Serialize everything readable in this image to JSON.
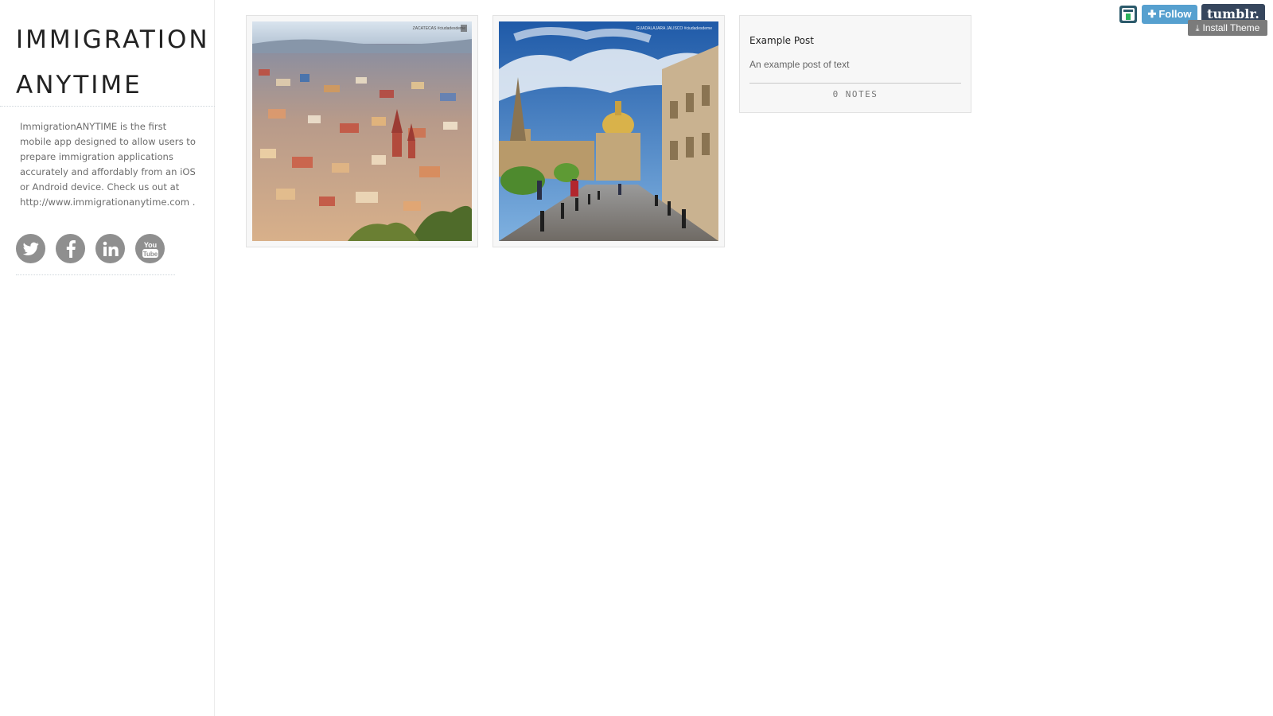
{
  "blog": {
    "title": "IMMIGRATION ANYTIME",
    "description": "ImmigrationANYTIME is the first mobile app designed to allow users to prepare immigration applications accurately and affordably from an iOS or Android device. Check us out at http://www.immigrationanytime.com ."
  },
  "socials": [
    {
      "name": "twitter",
      "icon": "twitter-icon"
    },
    {
      "name": "facebook",
      "icon": "facebook-icon"
    },
    {
      "name": "linkedin",
      "icon": "linkedin-icon"
    },
    {
      "name": "youtube",
      "icon": "youtube-icon"
    }
  ],
  "posts": [
    {
      "type": "photo",
      "photo_caption": "ZACATECAS #ciudadesdeme"
    },
    {
      "type": "photo",
      "photo_caption": "GUADALAJARA JALISCO #ciudadesdeme"
    },
    {
      "type": "text",
      "title": "Example Post",
      "body": "An example post of text",
      "notes": "0 NOTES"
    }
  ],
  "tumblr_controls": {
    "follow_label": "Follow",
    "brand_label": "tumblr.",
    "install_label": "Install Theme"
  },
  "colors": {
    "social_icon_bg": "#8f8f8f",
    "follow_bg": "#56a0cf",
    "tumblr_bg": "#36465d",
    "install_bg": "#7b7b7b"
  }
}
